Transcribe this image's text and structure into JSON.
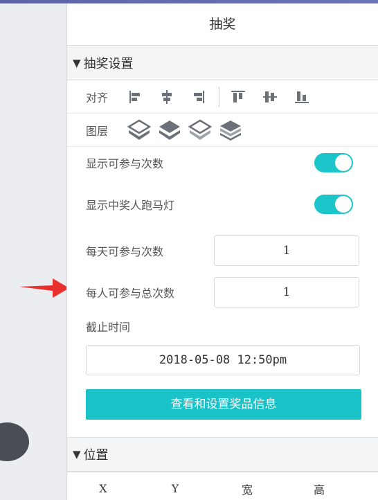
{
  "panel": {
    "title": "抽奖"
  },
  "lottery_section": {
    "header": "抽奖设置",
    "align_label": "对齐",
    "layer_label": "图层",
    "show_participation_count_label": "显示可参与次数",
    "show_participation_count_on": true,
    "show_winner_marquee_label": "显示中奖人跑马灯",
    "show_winner_marquee_on": true,
    "daily_limit_label": "每天可参与次数",
    "daily_limit_value": "1",
    "total_limit_label": "每人可参与总次数",
    "total_limit_value": "1",
    "deadline_label": "截止时间",
    "deadline_value": "2018-05-08 12:50pm",
    "prize_button_label": "查看和设置奖品信息"
  },
  "position_section": {
    "header": "位置",
    "columns": [
      "X",
      "Y",
      "宽",
      "高"
    ]
  },
  "colors": {
    "accent": "#1ac3c7",
    "arrow": "#e8302c"
  },
  "icons": {
    "align": [
      "align-left-icon",
      "align-center-h-icon",
      "align-right-icon",
      "align-top-icon",
      "align-middle-v-icon",
      "align-bottom-icon"
    ],
    "layer": [
      "layer-top-icon",
      "layer-up-icon",
      "layer-down-icon",
      "layer-bottom-icon"
    ]
  }
}
